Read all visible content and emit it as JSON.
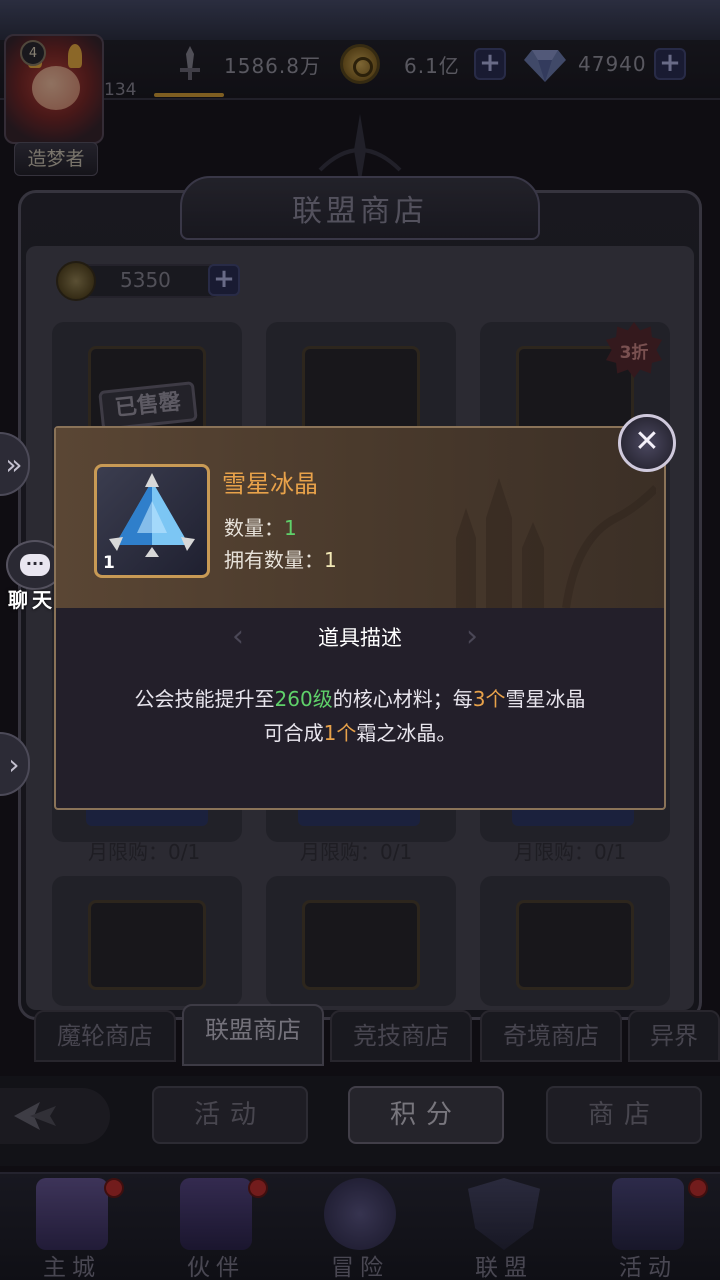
{
  "player": {
    "level": "4",
    "xp_value": "134",
    "title": "造梦者"
  },
  "resources": {
    "power": "1586.8万",
    "gold": "6.1亿",
    "diamonds": "47940"
  },
  "shop": {
    "title": "联盟商店",
    "currency_value": "5350",
    "sold_out_label": "已售罄",
    "discount_label": "3折",
    "limit_labels": [
      "月限购：0/1",
      "月限购：0/1",
      "月限购：0/1"
    ]
  },
  "popup": {
    "item_name": "雪星冰晶",
    "item_count": "1",
    "quantity_label": "数量：",
    "quantity_value": "1",
    "owned_label": "拥有数量：",
    "owned_value": "1",
    "section_title": "道具描述",
    "desc_part1": "公会技能提升至",
    "desc_hl1": "260级",
    "desc_part2": "的核心材料；每",
    "desc_hl2": "3个",
    "desc_part3": "雪星冰晶",
    "desc_part4": "可合成",
    "desc_hl3": "1个",
    "desc_part5": "霜之冰晶。"
  },
  "chat": {
    "label": "聊天"
  },
  "tabs": [
    "魔轮商店",
    "联盟商店",
    "竞技商店",
    "奇境商店",
    "异界"
  ],
  "active_tab": "联盟商店",
  "sub_buttons": [
    "活动",
    "积分",
    "商店"
  ],
  "active_sub_button": "积分",
  "nav": [
    {
      "label": "主城",
      "icon": "castle-icon",
      "has_dot": true
    },
    {
      "label": "伙伴",
      "icon": "witch-hat-icon",
      "has_dot": true
    },
    {
      "label": "冒险",
      "icon": "compass-icon",
      "has_dot": false
    },
    {
      "label": "联盟",
      "icon": "shield-icon",
      "has_dot": false
    },
    {
      "label": "活动",
      "icon": "cards-icon",
      "has_dot": true
    }
  ],
  "colors": {
    "accent_orange": "#e8a24a",
    "highlight_green": "#5fd16a",
    "frame_gold": "#c89a55"
  }
}
